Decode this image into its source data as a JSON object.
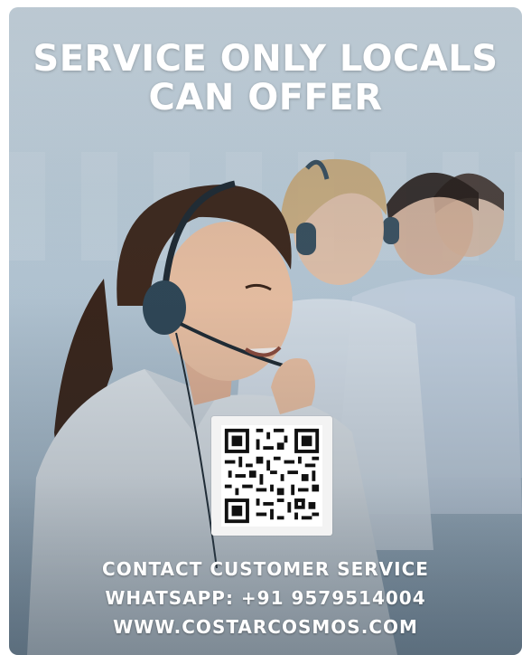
{
  "poster": {
    "headline_line1": "SERVICE ONLY LOCALS",
    "headline_line2": "CAN OFFER",
    "contact_line": "CONTACT CUSTOMER SERVICE",
    "whatsapp_line": "WHATSAPP: +91 9579514004",
    "website_line": "WWW.COSTARCOSMOS.COM"
  },
  "colors": {
    "text": "#ffffff",
    "headset": "#2f4656",
    "shirt": "#dfe5ea"
  },
  "icons": [
    "qr-code-icon"
  ]
}
